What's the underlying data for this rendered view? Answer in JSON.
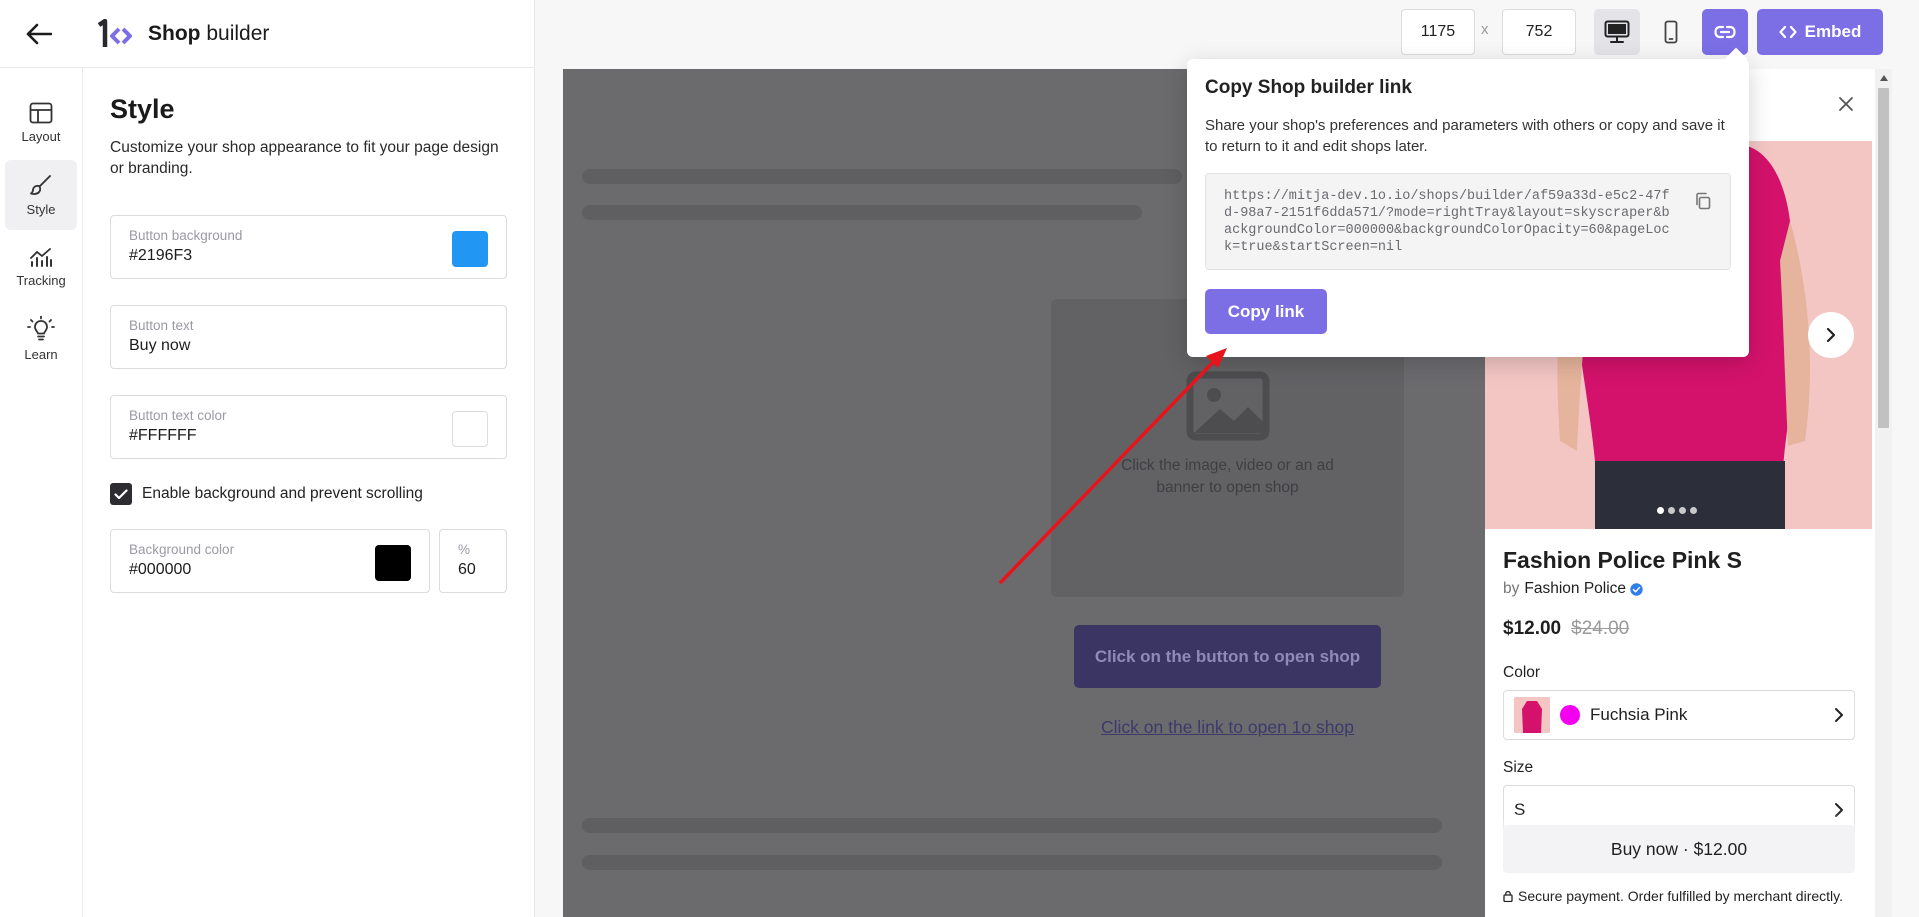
{
  "app": {
    "title_bold": "Shop",
    "title_rest": " builder"
  },
  "rail": {
    "items": [
      {
        "label": "Layout"
      },
      {
        "label": "Style"
      },
      {
        "label": "Tracking"
      },
      {
        "label": "Learn"
      }
    ]
  },
  "style_panel": {
    "heading": "Style",
    "description": "Customize your shop appearance to fit your page design or branding.",
    "button_background": {
      "label": "Button background",
      "value": "#2196F3",
      "swatch": "#2196F3"
    },
    "button_text": {
      "label": "Button text",
      "value": "Buy now"
    },
    "button_text_color": {
      "label": "Button text color",
      "value": "#FFFFFF",
      "swatch": "#FFFFFF"
    },
    "enable_background": {
      "label": "Enable background and prevent scrolling",
      "checked": true
    },
    "background_color": {
      "label": "Background color",
      "value": "#000000",
      "swatch": "#000000"
    },
    "opacity": {
      "label": "%",
      "value": "60"
    }
  },
  "toolbar": {
    "width": "1175",
    "separator": "x",
    "height": "752",
    "embed_label": "Embed",
    "accent_color": "#7c6fe6"
  },
  "preview": {
    "media_text": "Click the image, video or an ad banner to open shop",
    "button_text": "Click on the button to open shop",
    "link_text": "Click on the link to open 1o shop"
  },
  "product": {
    "title": "Fashion Police Pink S",
    "by": "by",
    "brand": "Fashion Police",
    "price": "$12.00",
    "compare_price": "$24.00",
    "color_label": "Color",
    "color_value": "Fuchsia Pink",
    "color_hex": "#f200ef",
    "size_label": "Size",
    "size_value": "S",
    "buy_label": "Buy now · $12.00",
    "secure_text": "Secure payment. Order fulfilled by merchant directly."
  },
  "popover": {
    "title": "Copy Shop builder link",
    "description": "Share your shop's preferences and parameters with others or copy and save it to return to it and edit shops later.",
    "url": "https://mitja-dev.1o.io/shops/builder/af59a33d-e5c2-47fd-98a7-2151f6dda571/?mode=rightTray&layout=skyscraper&backgroundColor=000000&backgroundColorOpacity=60&pageLock=true&startScreen=nil",
    "copy_label": "Copy link"
  },
  "annotation": {
    "arrow_color": "#e8141b"
  }
}
